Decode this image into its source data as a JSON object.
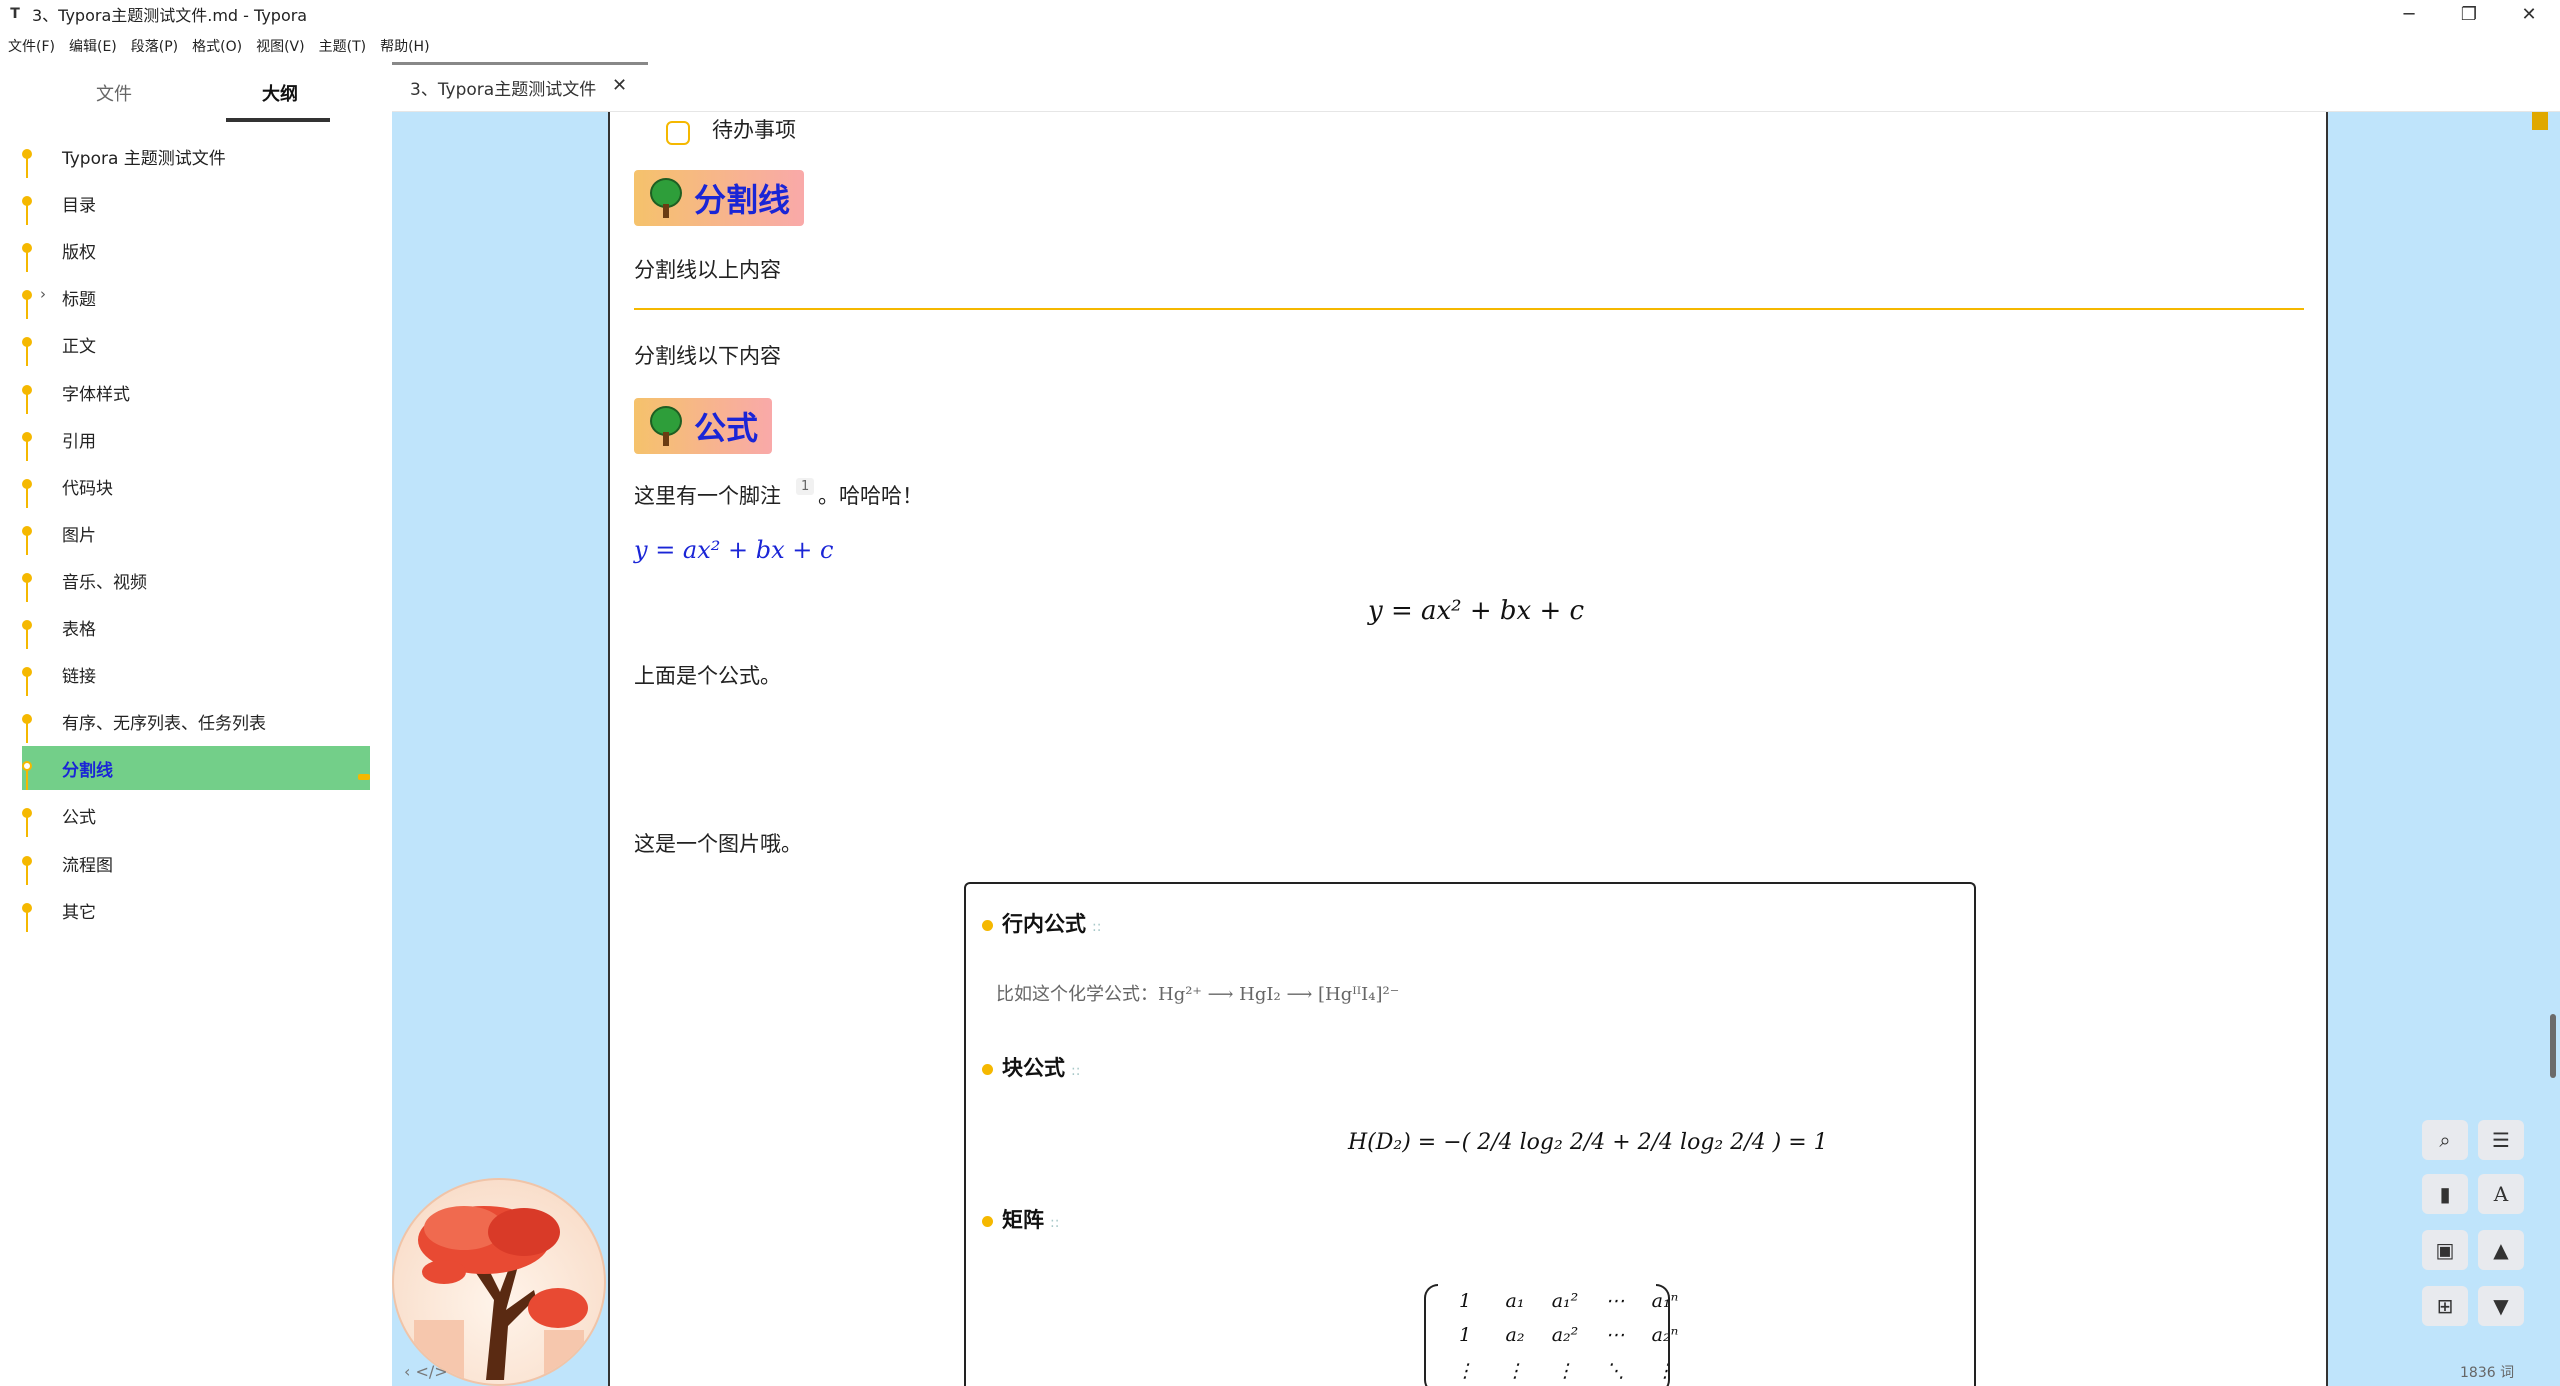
{
  "window": {
    "title": "3、Typora主题测试文件.md - Typora",
    "app_icon": "T",
    "minimize": "─",
    "maximize": "❐",
    "close": "✕"
  },
  "menu": [
    "文件(F)",
    "编辑(E)",
    "段落(P)",
    "格式(O)",
    "视图(V)",
    "主题(T)",
    "帮助(H)"
  ],
  "sidebar": {
    "tabs": {
      "files": "文件",
      "outline": "大纲"
    },
    "active_tab": "outline",
    "outline": [
      {
        "label": "Typora 主题测试文件"
      },
      {
        "label": "目录"
      },
      {
        "label": "版权"
      },
      {
        "label": "标题",
        "collapsed": true,
        "caret": "›"
      },
      {
        "label": "正文"
      },
      {
        "label": "字体样式"
      },
      {
        "label": "引用"
      },
      {
        "label": "代码块"
      },
      {
        "label": "图片"
      },
      {
        "label": "音乐、视频"
      },
      {
        "label": "表格"
      },
      {
        "label": "链接"
      },
      {
        "label": "有序、无序列表、任务列表"
      },
      {
        "label": "分割线",
        "active": true
      },
      {
        "label": "公式"
      },
      {
        "label": "流程图"
      },
      {
        "label": "其它"
      }
    ]
  },
  "tabbar": {
    "doc_tab_label": "3、Typora主题测试文件",
    "close_glyph": "✕"
  },
  "document": {
    "todo_label": "待办事项",
    "h2_divider": "分割线",
    "above_hr": "分割线以上内容",
    "below_hr": "分割线以下内容",
    "h2_formula": "公式",
    "footnote_sentence_before": "这里有一个脚注",
    "footnote_ref": "1",
    "footnote_sentence_after": "。哈哈哈！",
    "inline_formula": "y = ax² + bx + c",
    "block_formula": "y = ax² + bx + c",
    "after_formula": "上面是个公式。",
    "image_caption": "这是一个图片哦。"
  },
  "embedded_image": {
    "heading_inline": "行内公式",
    "chem_text": "比如这个化学公式：Hg²⁺ ⟶ HgI₂ ⟶ [HgᴵᴵI₄]²⁻",
    "heading_block": "块公式",
    "entropy": "H(D₂) = −( 2/4 log₂ 2/4 + 2/4 log₂ 2/4 ) = 1",
    "heading_matrix": "矩阵",
    "hint_glyph": "::",
    "matrix_rows": [
      [
        "1",
        "a₁",
        "a₁²",
        "⋯",
        "a₁ⁿ"
      ],
      [
        "1",
        "a₂",
        "a₂²",
        "⋯",
        "a₂ⁿ"
      ],
      [
        "⋮",
        "⋮",
        "⋮",
        "⋱",
        "⋮"
      ]
    ]
  },
  "right_toolbar": [
    {
      "name": "search-icon",
      "glyph": "⌕"
    },
    {
      "name": "toc-icon",
      "glyph": "☰"
    },
    {
      "name": "bookmark-icon",
      "glyph": "▮"
    },
    {
      "name": "font-icon",
      "glyph": "A"
    },
    {
      "name": "image-icon",
      "glyph": "▣"
    },
    {
      "name": "scroll-up-icon",
      "glyph": "▲"
    },
    {
      "name": "sitemap-icon",
      "glyph": "⊞"
    },
    {
      "name": "scroll-down-icon",
      "glyph": "▼"
    }
  ],
  "status": {
    "word_count": "1836 词",
    "bottom_left": "‹   </>"
  },
  "colors": {
    "accent": "#f5b800",
    "heading_blue": "#1a25d6",
    "active_outline": "#73cf89",
    "editor_bg": "#bfe4fb"
  }
}
